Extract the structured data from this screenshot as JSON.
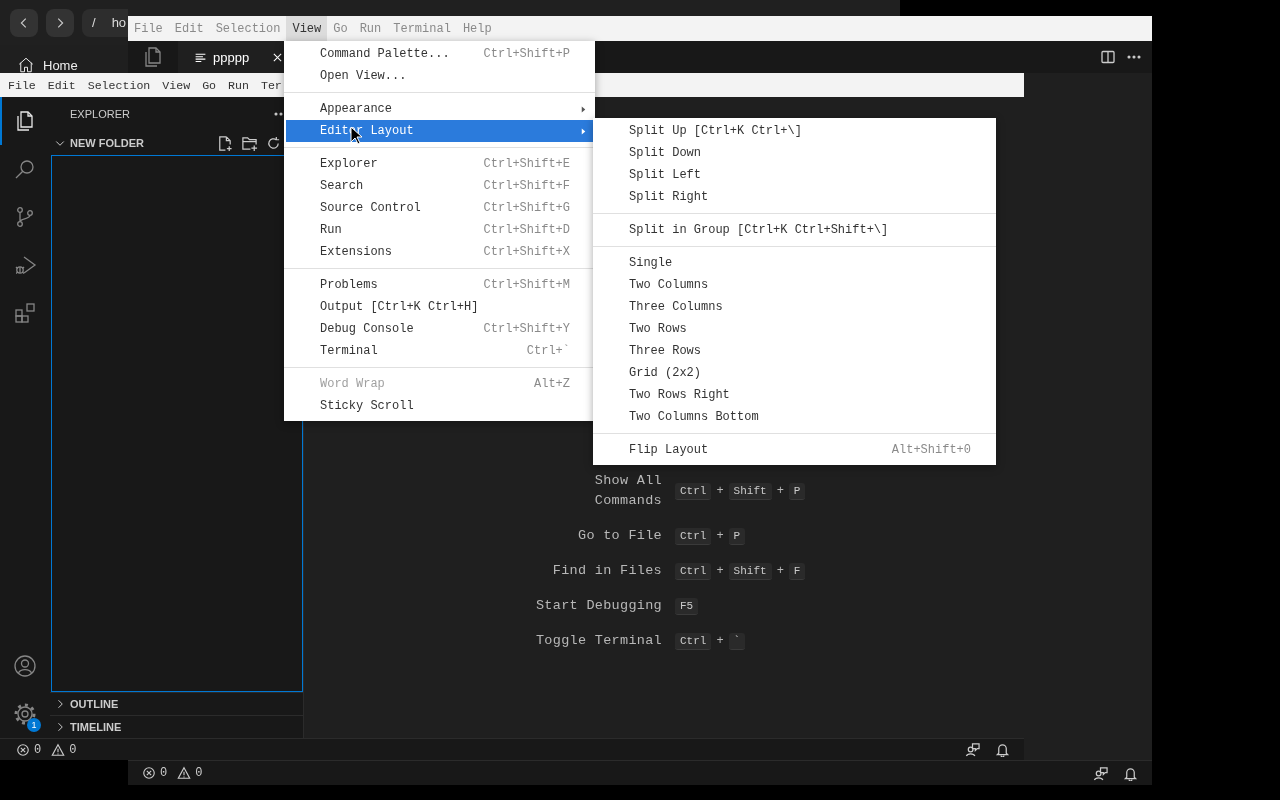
{
  "browser_window": {
    "address_parts": [
      "/",
      "ho"
    ],
    "home_tab": "Home"
  },
  "back_editor": {
    "menu_bar": [
      {
        "label": "File",
        "selected": false
      },
      {
        "label": "Edit",
        "selected": false
      },
      {
        "label": "Selection",
        "selected": false
      },
      {
        "label": "View",
        "selected": true
      },
      {
        "label": "Go",
        "selected": false
      },
      {
        "label": "Run",
        "selected": false
      },
      {
        "label": "Terminal",
        "selected": false
      },
      {
        "label": "Help",
        "selected": false
      }
    ],
    "tab": {
      "label": "ppppp"
    },
    "status_bar": {
      "errors": "0",
      "warnings": "0"
    }
  },
  "front_editor": {
    "menu_bar": [
      {
        "label": "File",
        "selected": false
      },
      {
        "label": "Edit",
        "selected": false
      },
      {
        "label": "Selection",
        "selected": false
      },
      {
        "label": "View",
        "selected": false
      },
      {
        "label": "Go",
        "selected": false
      },
      {
        "label": "Run",
        "selected": false
      },
      {
        "label": "Ter",
        "selected": false
      }
    ],
    "activity_bar": {
      "top": [
        {
          "kind": "files",
          "selected": true
        },
        {
          "kind": "search",
          "selected": false
        },
        {
          "kind": "source-control",
          "selected": false
        },
        {
          "kind": "run-debug",
          "selected": false
        },
        {
          "kind": "extensions",
          "selected": false
        }
      ],
      "bottom": [
        {
          "kind": "account"
        },
        {
          "kind": "gear",
          "badge": "1"
        }
      ]
    },
    "sidebar": {
      "title": "EXPLORER",
      "folder": {
        "label": "NEW FOLDER",
        "expanded": true
      },
      "sections": [
        {
          "label": "OUTLINE",
          "expanded": false
        },
        {
          "label": "TIMELINE",
          "expanded": false
        }
      ]
    },
    "shortcuts": [
      {
        "label": "Show All Commands",
        "keys": [
          {
            "kind": "key",
            "text": "Ctrl"
          },
          {
            "kind": "plus",
            "text": "+"
          },
          {
            "kind": "key",
            "text": "Shift"
          },
          {
            "kind": "plus",
            "text": "+"
          },
          {
            "kind": "key",
            "text": "P"
          }
        ]
      },
      {
        "label": "Go to File",
        "keys": [
          {
            "kind": "key",
            "text": "Ctrl"
          },
          {
            "kind": "plus",
            "text": "+"
          },
          {
            "kind": "key",
            "text": "P"
          }
        ]
      },
      {
        "label": "Find in Files",
        "keys": [
          {
            "kind": "key",
            "text": "Ctrl"
          },
          {
            "kind": "plus",
            "text": "+"
          },
          {
            "kind": "key",
            "text": "Shift"
          },
          {
            "kind": "plus",
            "text": "+"
          },
          {
            "kind": "key",
            "text": "F"
          }
        ]
      },
      {
        "label": "Start Debugging",
        "keys": [
          {
            "kind": "key",
            "text": "F5"
          }
        ]
      },
      {
        "label": "Toggle Terminal",
        "keys": [
          {
            "kind": "key",
            "text": "Ctrl"
          },
          {
            "kind": "plus",
            "text": "+"
          },
          {
            "kind": "key",
            "text": "`"
          }
        ]
      }
    ],
    "status_bar": {
      "errors": "0",
      "warnings": "0"
    }
  },
  "view_menu": {
    "groups": [
      [
        {
          "label": "Command Palette...",
          "shortcut": "Ctrl+Shift+P",
          "submenu": false,
          "selected": false,
          "disabled": false
        },
        {
          "label": "Open View...",
          "submenu": false,
          "selected": false,
          "disabled": false
        }
      ],
      [
        {
          "label": "Appearance",
          "submenu": true,
          "selected": false,
          "disabled": false
        },
        {
          "label": "Editor Layout",
          "submenu": true,
          "selected": true,
          "disabled": false
        }
      ],
      [
        {
          "label": "Explorer",
          "shortcut": "Ctrl+Shift+E",
          "submenu": false,
          "selected": false,
          "disabled": false
        },
        {
          "label": "Search",
          "shortcut": "Ctrl+Shift+F",
          "submenu": false,
          "selected": false,
          "disabled": false
        },
        {
          "label": "Source Control",
          "shortcut": "Ctrl+Shift+G",
          "submenu": false,
          "selected": false,
          "disabled": false
        },
        {
          "label": "Run",
          "shortcut": "Ctrl+Shift+D",
          "submenu": false,
          "selected": false,
          "disabled": false
        },
        {
          "label": "Extensions",
          "shortcut": "Ctrl+Shift+X",
          "submenu": false,
          "selected": false,
          "disabled": false
        }
      ],
      [
        {
          "label": "Problems",
          "shortcut": "Ctrl+Shift+M",
          "submenu": false,
          "selected": false,
          "disabled": false
        },
        {
          "label": "Output [Ctrl+K Ctrl+H]",
          "submenu": false,
          "selected": false,
          "disabled": false
        },
        {
          "label": "Debug Console",
          "shortcut": "Ctrl+Shift+Y",
          "submenu": false,
          "selected": false,
          "disabled": false
        },
        {
          "label": "Terminal",
          "shortcut": "Ctrl+`",
          "submenu": false,
          "selected": false,
          "disabled": false
        }
      ],
      [
        {
          "label": "Word Wrap",
          "shortcut": "Alt+Z",
          "submenu": false,
          "selected": false,
          "disabled": true
        },
        {
          "label": "Sticky Scroll",
          "submenu": false,
          "selected": false,
          "disabled": false
        }
      ]
    ]
  },
  "editor_layout_submenu": {
    "groups": [
      [
        {
          "label": "Split Up [Ctrl+K Ctrl+\\]",
          "selected": false
        },
        {
          "label": "Split Down",
          "selected": false
        },
        {
          "label": "Split Left",
          "selected": false
        },
        {
          "label": "Split Right",
          "selected": false
        }
      ],
      [
        {
          "label": "Split in Group [Ctrl+K Ctrl+Shift+\\]",
          "selected": false
        }
      ],
      [
        {
          "label": "Single",
          "selected": false
        },
        {
          "label": "Two Columns",
          "selected": false
        },
        {
          "label": "Three Columns",
          "selected": false
        },
        {
          "label": "Two Rows",
          "selected": false
        },
        {
          "label": "Three Rows",
          "selected": false
        },
        {
          "label": "Grid (2x2)",
          "selected": false
        },
        {
          "label": "Two Rows Right",
          "selected": false
        },
        {
          "label": "Two Columns Bottom",
          "selected": false
        }
      ],
      [
        {
          "label": "Flip Layout",
          "shortcut": "Alt+Shift+0",
          "selected": false
        }
      ]
    ]
  }
}
